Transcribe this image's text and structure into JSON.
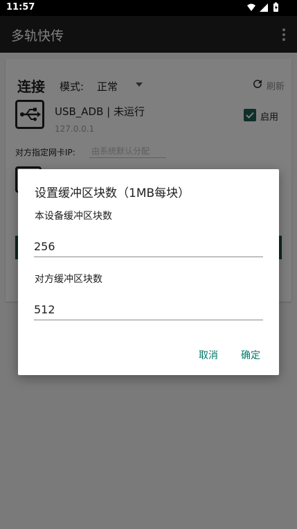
{
  "status_bar": {
    "time": "11:57",
    "icons": [
      "wifi-icon",
      "signal-icon",
      "battery-icon"
    ]
  },
  "app_bar": {
    "title": "多轨快传",
    "menu_icon": "more-vert-icon"
  },
  "card": {
    "heading": "连接",
    "mode_label": "模式:",
    "mode_value": "正常",
    "refresh_label": "刷新",
    "device": {
      "name": "USB_ADB | 未运行",
      "ip": "127.0.0.1",
      "enable_label": "启用",
      "enabled": true
    },
    "nic_label": "对方指定网卡IP:",
    "nic_placeholder": "由系统默认分配"
  },
  "dialog": {
    "title": "设置缓冲区块数（1MB每块）",
    "local_label": "本设备缓冲区块数",
    "local_value": "256",
    "remote_label": "对方缓冲区块数",
    "remote_value": "512",
    "cancel_label": "取消",
    "confirm_label": "确定"
  },
  "colors": {
    "accent": "#00796b",
    "app_bar": "#212121",
    "check": "#1e5e55"
  }
}
